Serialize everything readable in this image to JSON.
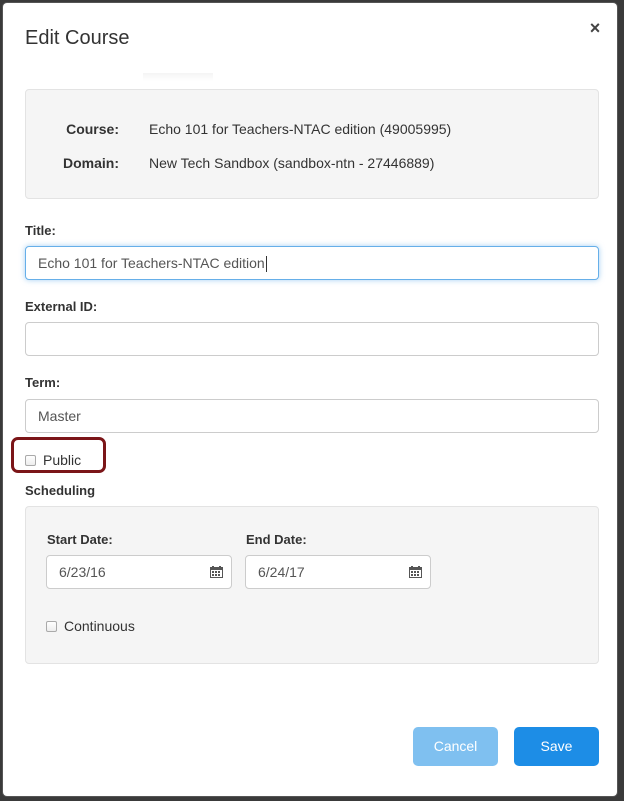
{
  "dialog": {
    "title": "Edit Course",
    "close_glyph": "×"
  },
  "info": {
    "course_label": "Course:",
    "course_value": "Echo 101 for Teachers-NTAC edition (49005995)",
    "domain_label": "Domain:",
    "domain_value": "New Tech Sandbox (sandbox-ntn - 27446889)"
  },
  "form": {
    "title_label": "Title:",
    "title_value": "Echo 101 for Teachers-NTAC edition",
    "external_id_label": "External ID:",
    "external_id_value": "",
    "term_label": "Term:",
    "term_value": "Master",
    "public_label": "Public",
    "public_checked": false
  },
  "scheduling": {
    "heading": "Scheduling",
    "start_label": "Start Date:",
    "start_value": "6/23/16",
    "end_label": "End Date:",
    "end_value": "6/24/17",
    "continuous_label": "Continuous",
    "continuous_checked": false
  },
  "buttons": {
    "cancel": "Cancel",
    "save": "Save"
  },
  "colors": {
    "highlight": "#7b1518",
    "save_button": "#1d8de6",
    "cancel_button": "#7fc0f0",
    "focus_border": "#66afe9"
  },
  "icons": {
    "close": "close-icon",
    "calendar": "calendar-icon"
  }
}
